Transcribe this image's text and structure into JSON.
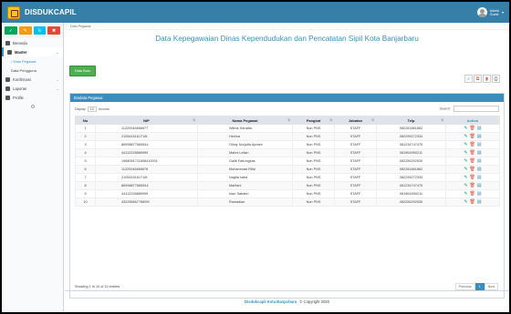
{
  "app": {
    "name": "DISDUKCAPIL"
  },
  "user": {
    "name": "Admin",
    "role": "Guest"
  },
  "sidebar": {
    "items": [
      {
        "label": "Beranda"
      },
      {
        "label": "Master"
      },
      {
        "label": "Data Pegawai"
      },
      {
        "label": "Data Pengguna"
      },
      {
        "label": "Konfirmasi"
      },
      {
        "label": "Laporan"
      },
      {
        "label": "Profile"
      }
    ]
  },
  "breadcrumb": "Data Pegawai",
  "page": {
    "title": "Data Kepegawaian Dinas Kependudukan dan Pencatatan Sipil Kota Banjarbaru"
  },
  "toolbar": {
    "add_label": "Data Baru"
  },
  "box": {
    "title": "Biodata Pegawai"
  },
  "table_controls": {
    "display_label": "Display",
    "display_value": "10",
    "records_label": "records",
    "search_label": "Search:"
  },
  "table": {
    "headers": [
      "No",
      "NIP",
      "Nama Pegawai",
      "Pangkat",
      "Jabatan",
      "Telp",
      "Action"
    ],
    "rows": [
      [
        "1",
        "11220046666677",
        "Wilma Hanafia",
        "Non PNS",
        "STAFF",
        "082281861862"
      ],
      [
        "2",
        "2105415161718l",
        "Herlina",
        "Non PNS",
        "STAFF",
        "082295272334"
      ],
      [
        "3",
        "86998877665544",
        "Oksty Nurjulfa Apriani",
        "Non PNS",
        "STAFF",
        "081234747475"
      ],
      [
        "4",
        "44112228889999",
        "Mahni Leilan",
        "Non PNS",
        "STAFF",
        "081964990211"
      ],
      [
        "5",
        "1968091711808410001",
        "Galik Fartungkas",
        "Non PNS",
        "STAFF",
        "082256292530"
      ],
      [
        "6",
        "11220046666678",
        "Muhammad Rifai",
        "Non PNS",
        "STAFF",
        "082281861862"
      ],
      [
        "7",
        "2105415161718l",
        "Nagita katia",
        "Non PNS",
        "STAFF",
        "082295272334"
      ],
      [
        "8",
        "86998877665544",
        "Marliani",
        "Non PNS",
        "STAFF",
        "081234747475"
      ],
      [
        "9",
        "44112228889999",
        "Irian Sabahri",
        "Non PNS",
        "STAFF",
        "081964990211"
      ],
      [
        "10",
        "43225566778899l",
        "Ramadian",
        "Non PNS",
        "STAFF",
        "082256292530"
      ]
    ]
  },
  "table_info": "Showing 1 to 10 of 10 entries",
  "pagination": {
    "prev": "Previous",
    "page": "1",
    "next": "Next"
  },
  "footer": {
    "brand": "Disdukcapil Kota Banjarbaru",
    "copyright": "© Copyright 2020"
  },
  "colors": {
    "header": "#367fa9",
    "accent": "#3c8dbc",
    "add_button": "#4caf50"
  }
}
